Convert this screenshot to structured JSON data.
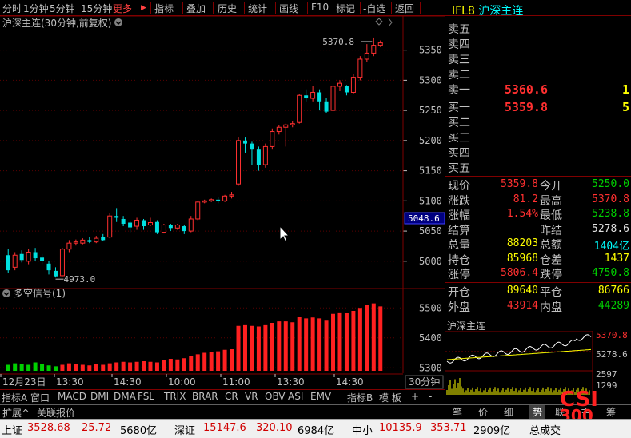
{
  "toolbar": {
    "items": [
      "分时",
      "1分钟",
      "5分钟",
      "15分钟",
      "更多",
      "指标",
      "叠加",
      "历史",
      "统计",
      "画线",
      "F10",
      "标记",
      "-自选",
      "返回"
    ],
    "active": "更多",
    "more_arrow": "▶"
  },
  "chart": {
    "title": "沪深主连(30分钟,前复权)",
    "indicator_title": "多空信号(1)",
    "last_price_tag": "5048.6",
    "high_label": "5370.8",
    "low_label": "4973.0",
    "cycle_button": "30分钟"
  },
  "chart_data": [
    {
      "type": "candlestick",
      "title": "沪深主连(30分钟,前复权)",
      "ylim": [
        4960,
        5380
      ],
      "yticks": [
        5000,
        5050,
        5100,
        5150,
        5200,
        5250,
        5300,
        5350
      ],
      "xticks": [
        "12月23日",
        "13:30",
        "14:30",
        "10:00",
        "11:00",
        "13:30",
        "14:30"
      ],
      "annotations": [
        {
          "text": "5370.8",
          "type": "high"
        },
        {
          "text": "4973.0",
          "type": "low"
        }
      ],
      "candles": [
        [
          5010,
          4985,
          5020,
          4980
        ],
        [
          4990,
          5010,
          5015,
          4985
        ],
        [
          5012,
          5002,
          5018,
          4998
        ],
        [
          5000,
          5015,
          5020,
          4995
        ],
        [
          5015,
          5005,
          5022,
          5000
        ],
        [
          5006,
          5000,
          5012,
          4995
        ],
        [
          4996,
          4985,
          5000,
          4978
        ],
        [
          4984,
          4975,
          4990,
          4973
        ],
        [
          4976,
          5020,
          5022,
          4975
        ],
        [
          5020,
          5030,
          5035,
          5015
        ],
        [
          5030,
          5032,
          5036,
          5026
        ],
        [
          5030,
          5035,
          5038,
          5028
        ],
        [
          5035,
          5032,
          5040,
          5030
        ],
        [
          5032,
          5038,
          5042,
          5030
        ],
        [
          5040,
          5035,
          5045,
          5033
        ],
        [
          5040,
          5075,
          5080,
          5038
        ],
        [
          5075,
          5072,
          5088,
          5065
        ],
        [
          5070,
          5062,
          5075,
          5058
        ],
        [
          5064,
          5056,
          5066,
          5048
        ],
        [
          5058,
          5068,
          5072,
          5052
        ],
        [
          5068,
          5058,
          5070,
          5052
        ],
        [
          5060,
          5064,
          5072,
          5058
        ],
        [
          5065,
          5048,
          5068,
          5045
        ],
        [
          5048,
          5060,
          5062,
          5046
        ],
        [
          5060,
          5055,
          5062,
          5050
        ],
        [
          5055,
          5060,
          5062,
          5052
        ],
        [
          5058,
          5050,
          5060,
          5045
        ],
        [
          5050,
          5070,
          5075,
          5048
        ],
        [
          5070,
          5098,
          5100,
          5068
        ],
        [
          5098,
          5100,
          5102,
          5096
        ],
        [
          5100,
          5102,
          5104,
          5098
        ],
        [
          5102,
          5100,
          5106,
          5096
        ],
        [
          5100,
          5108,
          5110,
          5098
        ],
        [
          5108,
          5110,
          5115,
          5104
        ],
        [
          5128,
          5200,
          5205,
          5125
        ],
        [
          5200,
          5195,
          5205,
          5180
        ],
        [
          5195,
          5185,
          5198,
          5160
        ],
        [
          5185,
          5160,
          5190,
          5150
        ],
        [
          5160,
          5190,
          5195,
          5155
        ],
        [
          5190,
          5215,
          5220,
          5185
        ],
        [
          5215,
          5222,
          5225,
          5210
        ],
        [
          5222,
          5226,
          5228,
          5190
        ],
        [
          5226,
          5228,
          5232,
          5222
        ],
        [
          5230,
          5275,
          5278,
          5228
        ],
        [
          5275,
          5270,
          5285,
          5265
        ],
        [
          5270,
          5280,
          5290,
          5265
        ],
        [
          5280,
          5265,
          5285,
          5250
        ],
        [
          5265,
          5248,
          5270,
          5245
        ],
        [
          5250,
          5290,
          5295,
          5248
        ],
        [
          5290,
          5295,
          5300,
          5282
        ],
        [
          5290,
          5280,
          5292,
          5275
        ],
        [
          5280,
          5305,
          5310,
          5278
        ],
        [
          5305,
          5335,
          5340,
          5300
        ],
        [
          5335,
          5345,
          5360,
          5330
        ],
        [
          5345,
          5358,
          5370.8,
          5340
        ],
        [
          5358,
          5362,
          5366,
          5355
        ]
      ]
    },
    {
      "type": "bar",
      "title": "多空信号(1)",
      "ylim": [
        5290,
        5530
      ],
      "yticks": [
        5300,
        5400,
        5500
      ],
      "values": [
        5310,
        5315,
        5312,
        5310,
        5318,
        5312,
        5308,
        5305,
        5310,
        5315,
        5312,
        5310,
        5308,
        5312,
        5310,
        5315,
        5318,
        5320,
        5318,
        5320,
        5322,
        5320,
        5318,
        5325,
        5330,
        5328,
        5332,
        5338,
        5345,
        5350,
        5352,
        5355,
        5360,
        5362,
        5440,
        5445,
        5440,
        5438,
        5445,
        5450,
        5455,
        5455,
        5452,
        5470,
        5465,
        5468,
        5465,
        5460,
        5480,
        5485,
        5482,
        5490,
        5500,
        5510,
        5515,
        5505
      ],
      "colors": [
        "g",
        "g",
        "g",
        "g",
        "g",
        "g",
        "g",
        "g",
        "r",
        "r",
        "r",
        "r",
        "r",
        "r",
        "r",
        "r",
        "r",
        "r",
        "r",
        "r",
        "r",
        "r",
        "r",
        "r",
        "r",
        "r",
        "r",
        "r",
        "r",
        "r",
        "r",
        "r",
        "r",
        "r",
        "r",
        "r",
        "r",
        "r",
        "r",
        "r",
        "r",
        "r",
        "r",
        "r",
        "r",
        "r",
        "r",
        "r",
        "r",
        "r",
        "r",
        "r",
        "r",
        "r",
        "r",
        "r"
      ]
    }
  ],
  "quote": {
    "code": "IFL8",
    "name": "沪深主连",
    "sell_labels": [
      "卖五",
      "卖四",
      "卖三",
      "卖二",
      "卖一"
    ],
    "sell1_price": "5360.6",
    "sell1_vol": "1",
    "buy_labels": [
      "买一",
      "买二",
      "买三",
      "买四",
      "买五"
    ],
    "buy1_price": "5359.8",
    "buy1_vol": "5",
    "rows": [
      {
        "l1": "现价",
        "v1": "5359.8",
        "c1": "red",
        "l2": "今开",
        "v2": "5250.0",
        "c2": "green"
      },
      {
        "l1": "涨跌",
        "v1": "81.2",
        "c1": "red",
        "l2": "最高",
        "v2": "5370.8",
        "c2": "red"
      },
      {
        "l1": "涨幅",
        "v1": "1.54%",
        "c1": "red",
        "l2": "最低",
        "v2": "5238.8",
        "c2": "green"
      },
      {
        "l1": "结算",
        "v1": "",
        "c1": "white",
        "l2": "昨结",
        "v2": "5278.6",
        "c2": "white"
      },
      {
        "l1": "总量",
        "v1": "88203",
        "c1": "yellow",
        "l2": "总额",
        "v2": "1404亿",
        "c2": "cyan"
      },
      {
        "l1": "持仓",
        "v1": "85968",
        "c1": "yellow",
        "l2": "仓差",
        "v2": "1437",
        "c2": "yellow"
      },
      {
        "l1": "涨停",
        "v1": "5806.4",
        "c1": "red",
        "l2": "跌停",
        "v2": "4750.8",
        "c2": "green"
      }
    ],
    "rows2": [
      {
        "l1": "开仓",
        "v1": "89640",
        "c1": "yellow",
        "l2": "平仓",
        "v2": "86766",
        "c2": "yellow"
      },
      {
        "l1": "外盘",
        "v1": "43914",
        "c1": "red",
        "l2": "内盘",
        "v2": "44289",
        "c2": "green"
      }
    ]
  },
  "mini_chart": {
    "title": "沪深主连",
    "labels": [
      "5370.8",
      "5278.6",
      "2597",
      "1299"
    ]
  },
  "bottom_tabs": [
    "指标A",
    "窗口",
    "MACD",
    "DMI",
    "DMA",
    "FSL",
    "TRIX",
    "BRAR",
    "CR",
    "VR",
    "OBV",
    "ASI",
    "EMV",
    "指标B",
    "模 板",
    "+",
    "-"
  ],
  "ext_bar": {
    "expand": "扩展^",
    "related": "关联报价"
  },
  "rp_tabs": [
    "笔",
    "价",
    "细",
    "势",
    "联",
    "主",
    "筹"
  ],
  "rp_tabs_active": "势",
  "logo": {
    "line1": "CSI",
    "line2": "300"
  },
  "status": {
    "sh_label": "上证",
    "sh_val": "3528.68",
    "sh_chg": "25.72",
    "sh_amt": "5680亿",
    "sz_label": "深证",
    "sz_val": "15147.6",
    "sz_chg": "320.10",
    "sz_amt": "6984亿",
    "zx_label": "中小",
    "zx_val": "10135.9",
    "zx_chg": "353.71",
    "zx_amt": "2909亿",
    "total_label": "总成交"
  }
}
